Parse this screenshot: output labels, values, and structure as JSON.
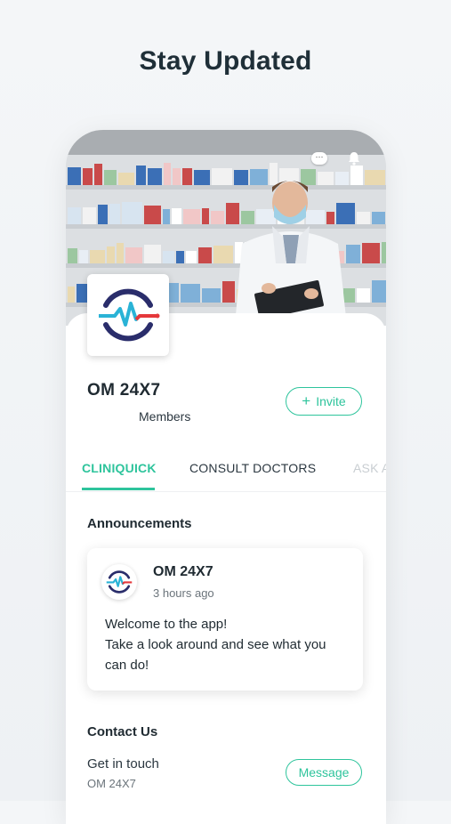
{
  "headline": "Stay Updated",
  "group": {
    "name": "OM 24X7",
    "members_label": "Members",
    "invite_label": "Invite"
  },
  "tabs": [
    {
      "label": "CLINIQUICK",
      "active": true
    },
    {
      "label": "CONSULT DOCTORS",
      "active": false
    },
    {
      "label": "ASK A",
      "active": false
    }
  ],
  "announcements": {
    "title": "Announcements",
    "post": {
      "author": "OM 24X7",
      "time": "3 hours ago",
      "lines": [
        "Welcome to the app!",
        "Take a look around and see what you",
        "can do!"
      ]
    }
  },
  "contact": {
    "title": "Contact Us",
    "get_in_touch": "Get in touch",
    "name": "OM 24X7",
    "message_label": "Message"
  },
  "icons": {
    "chat": "chat-bubble-icon",
    "bell": "bell-icon",
    "invite": "plus-icon",
    "logo": "heartbeat-logo"
  },
  "colors": {
    "accent": "#2ec49c",
    "logo_navy": "#2a2d6b",
    "logo_red": "#e5383b",
    "logo_cyan": "#2ab3d6"
  }
}
